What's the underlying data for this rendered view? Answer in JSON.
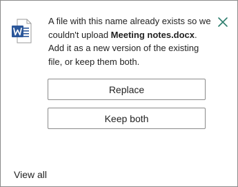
{
  "notification": {
    "message_prefix": "A file with this name already exists so we couldn't upload ",
    "file_name": "Meeting notes.docx",
    "message_suffix": ". Add it as a new version of the existing file, or keep them both.",
    "file_icon": "word-document-icon",
    "close_icon": "close-icon"
  },
  "actions": {
    "replace_label": "Replace",
    "keep_both_label": "Keep both"
  },
  "footer": {
    "view_all_label": "View all"
  },
  "colors": {
    "word_blue": "#2b579a",
    "close_teal": "#2e7d6e",
    "border": "#8a8a8a",
    "text": "#222222"
  }
}
